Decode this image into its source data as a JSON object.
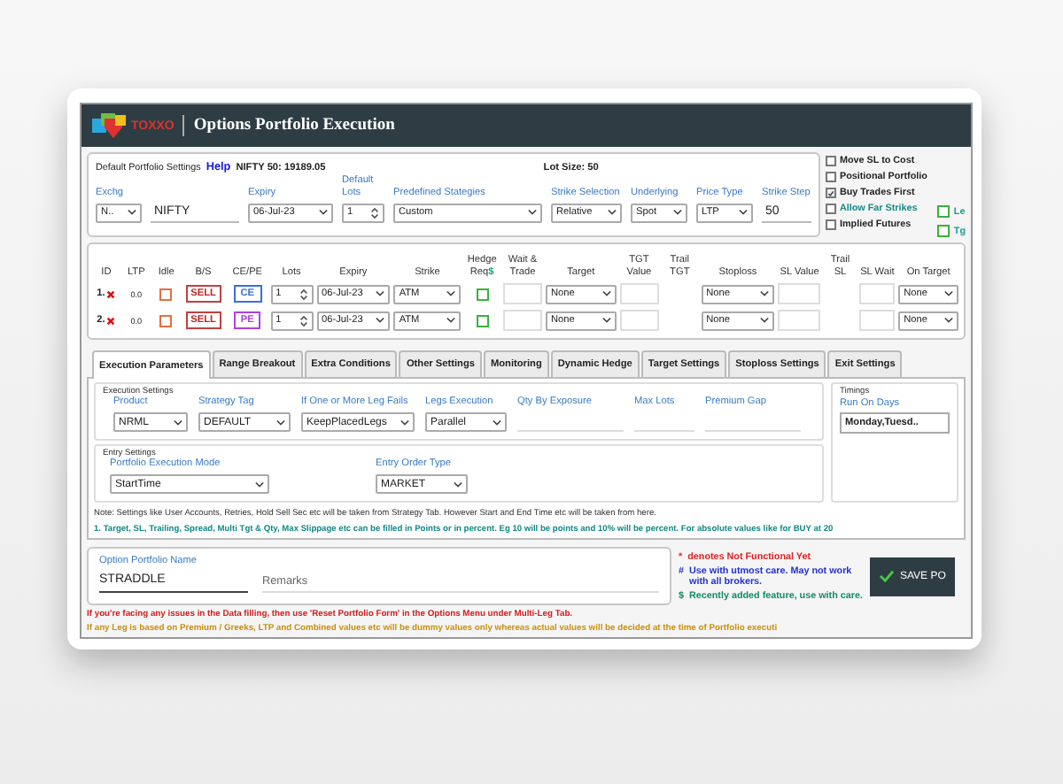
{
  "window": {
    "logo": "TOXXO",
    "title": "Options Portfolio Execution"
  },
  "settings": {
    "heading": "Default Portfolio Settings",
    "help": "Help",
    "index_price": "NIFTY 50: 19189.05",
    "lot_size": "Lot Size: 50",
    "fields": [
      {
        "label": "Exchg",
        "value": "N..",
        "kind": "dropdown"
      },
      {
        "value": "NIFTY",
        "kind": "text"
      },
      {
        "label": "Expiry",
        "value": "06-Jul-23",
        "kind": "dropdown"
      },
      {
        "label": "Default Lots",
        "value": "1",
        "kind": "spinner"
      },
      {
        "label": "Predefined Stategies",
        "value": "Custom",
        "kind": "dropdown"
      },
      {
        "label": "Strike Selection",
        "value": "Relative",
        "kind": "dropdown"
      },
      {
        "label": "Underlying",
        "value": "Spot",
        "kind": "dropdown"
      },
      {
        "label": "Price Type",
        "value": "LTP",
        "kind": "dropdown"
      },
      {
        "label": "Strike Step",
        "value": "50",
        "kind": "text"
      }
    ],
    "options": [
      {
        "label": "Move SL to Cost",
        "checked": false,
        "color": "#222222"
      },
      {
        "label": "Positional Portfolio",
        "checked": false,
        "color": "#222222"
      },
      {
        "label": "Buy Trades First",
        "checked": true,
        "color": "#222222"
      },
      {
        "label": "Allow Far Strikes",
        "checked": false,
        "color": "#138a8a"
      },
      {
        "label": "Implied Futures",
        "checked": false,
        "color": "#222222"
      }
    ],
    "extra_options": [
      {
        "label": "Le",
        "checked": false
      },
      {
        "label": "Tg",
        "checked": false
      }
    ]
  },
  "legs": {
    "columns": [
      {
        "label": "ID"
      },
      {
        "label": "LTP"
      },
      {
        "label": "Idle"
      },
      {
        "label": "B/S"
      },
      {
        "label": "CE/PE"
      },
      {
        "label": "Lots"
      },
      {
        "label": "Expiry"
      },
      {
        "label": "Strike"
      },
      {
        "label": "Hedge Req",
        "mark": "$"
      },
      {
        "label": "Wait & Trade"
      },
      {
        "label": "Target"
      },
      {
        "label": "TGT Value"
      },
      {
        "label": "Trail TGT"
      },
      {
        "label": "Stoploss"
      },
      {
        "label": "SL Value"
      },
      {
        "label": "Trail SL"
      },
      {
        "label": "SL Wait"
      },
      {
        "label": "On Target"
      }
    ],
    "rows": [
      {
        "id": "1.",
        "ltp": "0.0",
        "idle": false,
        "side": "SELL",
        "option": "CE",
        "color": "#3a6fe0",
        "lots": "1",
        "expiry": "06-Jul-23",
        "strike": "ATM",
        "hedge": false,
        "target": "None",
        "stoploss": "None",
        "on_target": "None"
      },
      {
        "id": "2.",
        "ltp": "0.0",
        "idle": false,
        "side": "SELL",
        "option": "PE",
        "color": "#b03fe0",
        "lots": "1",
        "expiry": "06-Jul-23",
        "strike": "ATM",
        "hedge": false,
        "target": "None",
        "stoploss": "None",
        "on_target": "None"
      }
    ]
  },
  "tabs": [
    {
      "label": "Execution Parameters",
      "selected": true
    },
    {
      "label": "Range Breakout",
      "selected": false
    },
    {
      "label": "Extra Conditions",
      "selected": false
    },
    {
      "label": "Other Settings",
      "selected": false
    },
    {
      "label": "Monitoring",
      "selected": false
    },
    {
      "label": "Dynamic Hedge",
      "selected": false
    },
    {
      "label": "Target Settings",
      "selected": false
    },
    {
      "label": "Stoploss Settings",
      "selected": false
    },
    {
      "label": "Exit Settings",
      "selected": false
    }
  ],
  "execution_settings": {
    "title": "Execution Settings",
    "fields": [
      {
        "label": "Product",
        "value": "NRML",
        "kind": "dropdown"
      },
      {
        "label": "Strategy Tag",
        "value": "DEFAULT",
        "kind": "dropdown"
      },
      {
        "label": "If One or More Leg Fails",
        "value": "KeepPlacedLegs",
        "kind": "dropdown"
      },
      {
        "label": "Legs Execution",
        "value": "Parallel",
        "kind": "dropdown"
      },
      {
        "label": "Qty By Exposure",
        "kind": "line"
      },
      {
        "label": "Max Lots",
        "kind": "line"
      },
      {
        "label": "Premium Gap",
        "kind": "line"
      }
    ]
  },
  "entry_settings": {
    "title": "Entry Settings",
    "fields": [
      {
        "label": "Portfolio Execution Mode",
        "value": "StartTime",
        "kind": "dropdown"
      },
      {
        "label": "Entry Order Type",
        "value": "MARKET",
        "kind": "dropdown"
      }
    ]
  },
  "timings": {
    "title": "Timings",
    "label": "Run On Days",
    "value": "Monday,Tuesd.."
  },
  "notes": [
    "Note: Settings like User Accounts, Retries, Hold Sell Sec etc will be taken from Strategy Tab. However Start and End Time etc will be taken from here.",
    "1. Target, SL, Trailing, Spread, Multi Tgt & Qty, Max Slippage etc can be filled in Points or in percent. Eg 10 will be points and 10% will be percent. For absolute values like for BUY at 20"
  ],
  "portfolio": {
    "name_label": "Option Portfolio Name",
    "name": "STRADDLE",
    "remarks_placeholder": "Remarks"
  },
  "legend": [
    {
      "symbol": "*",
      "text": "denotes Not Functional Yet",
      "color": "#e02020"
    },
    {
      "symbol": "#",
      "text": "Use with utmost care. May not work with all brokers.",
      "color": "#2030d0"
    },
    {
      "symbol": "$",
      "text": "Recently added feature, use with care.",
      "color": "#138a6a"
    }
  ],
  "save_button": "SAVE PO",
  "warnings": [
    {
      "text": "If you're facing any issues in the Data filling, then use 'Reset Portfolio Form' in the Options Menu under Multi-Leg Tab.",
      "color": "#d02020"
    },
    {
      "text": "If any Leg is based on Premium / Greeks, LTP and Combined values etc will be dummy values only whereas actual values will be decided at the time of Portfolio executi",
      "color": "#c89010"
    }
  ]
}
